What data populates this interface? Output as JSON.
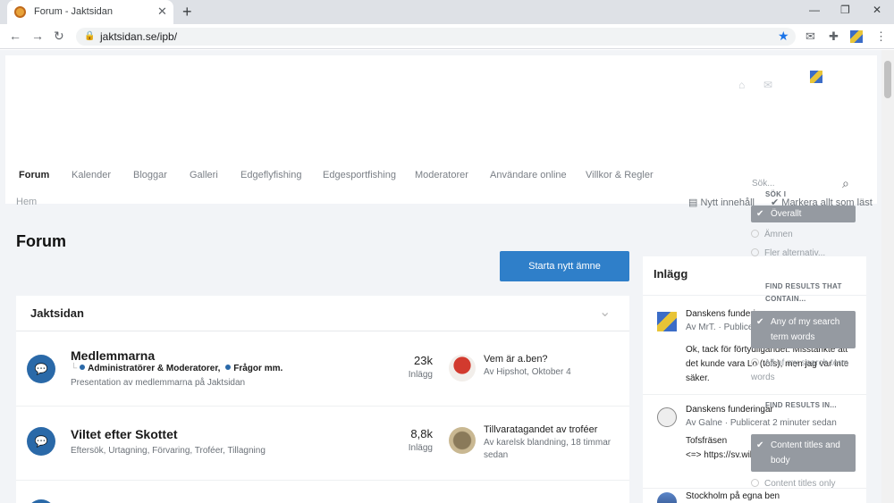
{
  "browser": {
    "tab_title": "Forum - Jaktsidan",
    "url": "jaktsidan.se/ipb/"
  },
  "nav": {
    "items": [
      "Forum",
      "Kalender",
      "Bloggar",
      "Galleri",
      "Edgeflyfishing",
      "Edgesportfishing",
      "Moderatorer",
      "Användare online",
      "Villkor & Regler"
    ]
  },
  "breadcrumb": "Hem",
  "actions": {
    "new_content": "Nytt innehåll",
    "mark_read": "Markera allt som läst"
  },
  "page_title": "Forum",
  "start_button": "Starta nytt ämne",
  "search": {
    "placeholder": "Sök...",
    "in_header": "SÖK I",
    "scope_options": [
      "Överallt",
      "Ämnen",
      "Fler alternativ..."
    ],
    "find_header": "FIND RESULTS THAT CONTAIN...",
    "word_options": [
      "Any of my search term words",
      "All of my search term words"
    ],
    "find_in_header": "FIND RESULTS IN...",
    "in_options": [
      "Content titles and body",
      "Content titles only"
    ]
  },
  "forum_section": {
    "title": "Jaktsidan",
    "forums": [
      {
        "name": "Medlemmarna",
        "subforums": [
          "Administratörer & Moderatorer,",
          "Frågor mm."
        ],
        "desc": "Presentation av medlemmarna på Jaktsidan",
        "count": "23k",
        "count_label": "Inlägg",
        "last_title": "Vem är a.ben?",
        "last_by": "Av Hipshot, Oktober 4"
      },
      {
        "name": "Viltet efter Skottet",
        "desc": "Eftersök, Urtagning, Förvaring, Troféer, Tillagning",
        "count": "8,8k",
        "count_label": "Inlägg",
        "last_title": "Tillvaratagandet av troféer",
        "last_by": "Av karelsk blandning, 18 timmar sedan"
      }
    ]
  },
  "sidebar": {
    "title": "Inlägg",
    "posts": [
      {
        "title": "Danskens funderingar",
        "by": "Av MrT. · Publicerat just nu",
        "body": "Ok, tack för förtydligandet. Misstänkte att det kunde vara Lo (tofs), men jag var inte säker."
      },
      {
        "title": "Danskens funderingar",
        "by": "Av Galne · Publicerat 2 minuter sedan",
        "body": "Tofsfräsen\n<=> https://sv.wikipedia.org/wiki/Lodjur"
      },
      {
        "title": "Stockholm på egna ben",
        "by": "",
        "body": ""
      }
    ]
  },
  "colors": {
    "accent": "#2f7fc9",
    "forum_icon": "#2a69a8",
    "page_bg": "#f2f4f7"
  }
}
